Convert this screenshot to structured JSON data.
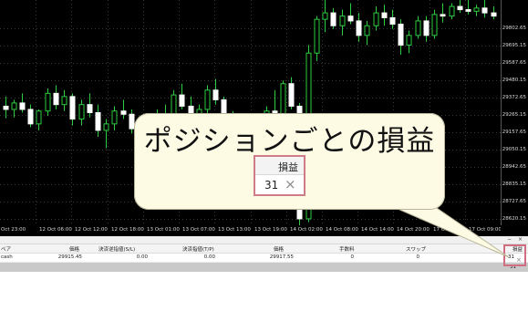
{
  "chart": {
    "background": "#000000",
    "candle_color": "#2ecc40",
    "doji_color": "#ffffff",
    "candles": [
      {
        "o": 29320,
        "h": 29380,
        "l": 29245,
        "c": 29300
      },
      {
        "o": 29300,
        "h": 29360,
        "l": 29250,
        "c": 29340
      },
      {
        "o": 29340,
        "h": 29400,
        "l": 29280,
        "c": 29300
      },
      {
        "o": 29300,
        "h": 29330,
        "l": 29190,
        "c": 29210
      },
      {
        "o": 29210,
        "h": 29300,
        "l": 29170,
        "c": 29290
      },
      {
        "o": 29290,
        "h": 29430,
        "l": 29260,
        "c": 29400
      },
      {
        "o": 29400,
        "h": 29450,
        "l": 29300,
        "c": 29330
      },
      {
        "o": 29330,
        "h": 29420,
        "l": 29290,
        "c": 29380
      },
      {
        "o": 29380,
        "h": 29400,
        "l": 29200,
        "c": 29240
      },
      {
        "o": 29240,
        "h": 29360,
        "l": 29200,
        "c": 29330
      },
      {
        "o": 29330,
        "h": 29400,
        "l": 29250,
        "c": 29280
      },
      {
        "o": 29280,
        "h": 29330,
        "l": 29130,
        "c": 29170
      },
      {
        "o": 29170,
        "h": 29240,
        "l": 29060,
        "c": 29210
      },
      {
        "o": 29210,
        "h": 29320,
        "l": 29170,
        "c": 29290
      },
      {
        "o": 29290,
        "h": 29360,
        "l": 29240,
        "c": 29270
      },
      {
        "o": 29270,
        "h": 29300,
        "l": 29150,
        "c": 29180
      },
      {
        "o": 29180,
        "h": 29260,
        "l": 29080,
        "c": 29100
      },
      {
        "o": 29100,
        "h": 29210,
        "l": 29040,
        "c": 29190
      },
      {
        "o": 29190,
        "h": 29300,
        "l": 29160,
        "c": 29270
      },
      {
        "o": 29270,
        "h": 29330,
        "l": 29180,
        "c": 29220
      },
      {
        "o": 29220,
        "h": 29420,
        "l": 29200,
        "c": 29390
      },
      {
        "o": 29390,
        "h": 29460,
        "l": 29300,
        "c": 29320
      },
      {
        "o": 29320,
        "h": 29380,
        "l": 29200,
        "c": 29240
      },
      {
        "o": 29240,
        "h": 29330,
        "l": 29180,
        "c": 29300
      },
      {
        "o": 29300,
        "h": 29450,
        "l": 29270,
        "c": 29420
      },
      {
        "o": 29420,
        "h": 29490,
        "l": 29330,
        "c": 29360
      },
      {
        "o": 29360,
        "h": 29380,
        "l": 29180,
        "c": 29210
      },
      {
        "o": 29210,
        "h": 29290,
        "l": 29100,
        "c": 29150
      },
      {
        "o": 29150,
        "h": 29180,
        "l": 28900,
        "c": 28940
      },
      {
        "o": 28940,
        "h": 29100,
        "l": 28880,
        "c": 29070
      },
      {
        "o": 29070,
        "h": 29240,
        "l": 29020,
        "c": 29180
      },
      {
        "o": 29180,
        "h": 29320,
        "l": 29140,
        "c": 29290
      },
      {
        "o": 29290,
        "h": 29420,
        "l": 29230,
        "c": 29250
      },
      {
        "o": 29250,
        "h": 29480,
        "l": 29200,
        "c": 29460
      },
      {
        "o": 29460,
        "h": 29500,
        "l": 29300,
        "c": 29320
      },
      {
        "o": 29320,
        "h": 29340,
        "l": 28560,
        "c": 28620
      },
      {
        "o": 28620,
        "h": 29700,
        "l": 28600,
        "c": 29650
      },
      {
        "o": 29650,
        "h": 29880,
        "l": 29600,
        "c": 29860
      },
      {
        "o": 29860,
        "h": 29990,
        "l": 29780,
        "c": 29900
      },
      {
        "o": 29900,
        "h": 29930,
        "l": 29800,
        "c": 29820
      },
      {
        "o": 29820,
        "h": 29920,
        "l": 29760,
        "c": 29880
      },
      {
        "o": 29880,
        "h": 29960,
        "l": 29830,
        "c": 29850
      },
      {
        "o": 29850,
        "h": 29900,
        "l": 29720,
        "c": 29760
      },
      {
        "o": 29760,
        "h": 29850,
        "l": 29700,
        "c": 29820
      },
      {
        "o": 29820,
        "h": 29940,
        "l": 29790,
        "c": 29900
      },
      {
        "o": 29900,
        "h": 29950,
        "l": 29820,
        "c": 29870
      },
      {
        "o": 29870,
        "h": 29920,
        "l": 29800,
        "c": 29830
      },
      {
        "o": 29830,
        "h": 29860,
        "l": 29640,
        "c": 29700
      },
      {
        "o": 29700,
        "h": 29790,
        "l": 29650,
        "c": 29760
      },
      {
        "o": 29760,
        "h": 29880,
        "l": 29740,
        "c": 29850
      },
      {
        "o": 29850,
        "h": 29880,
        "l": 29720,
        "c": 29760
      },
      {
        "o": 29760,
        "h": 29920,
        "l": 29740,
        "c": 29890
      },
      {
        "o": 29890,
        "h": 29960,
        "l": 29840,
        "c": 29880
      },
      {
        "o": 29880,
        "h": 29960,
        "l": 29860,
        "c": 29940
      },
      {
        "o": 29940,
        "h": 29990,
        "l": 29900,
        "c": 29920
      },
      {
        "o": 29920,
        "h": 29980,
        "l": 29890,
        "c": 29910
      },
      {
        "o": 29910,
        "h": 29950,
        "l": 29880,
        "c": 29930
      },
      {
        "o": 29930,
        "h": 29990,
        "l": 29870,
        "c": 29900
      },
      {
        "o": 29900,
        "h": 29940,
        "l": 29860,
        "c": 29880
      }
    ],
    "y_range": [
      28580,
      29980
    ]
  },
  "price_axis": [
    {
      "label": "29802.65",
      "value": 29802.65
    },
    {
      "label": "29695.15",
      "value": 29695.15
    },
    {
      "label": "29587.65",
      "value": 29587.65
    },
    {
      "label": "29480.15",
      "value": 29480.15
    },
    {
      "label": "29372.65",
      "value": 29372.65
    },
    {
      "label": "29265.15",
      "value": 29265.15
    },
    {
      "label": "29157.65",
      "value": 29157.65
    },
    {
      "label": "29050.15",
      "value": 29050.15
    },
    {
      "label": "28942.65",
      "value": 28942.65
    },
    {
      "label": "28835.15",
      "value": 28835.15
    },
    {
      "label": "28727.65",
      "value": 28727.65
    },
    {
      "label": "28620.15",
      "value": 28620.15
    }
  ],
  "time_axis": [
    "Oct 23:00",
    "12 Oct 06:00",
    "12 Oct 12:00",
    "12 Oct 18:00",
    "13 Oct 01:00",
    "13 Oct 07:00",
    "13 Oct 13:00",
    "13 Oct 19:00",
    "14 Oct 02:00",
    "14 Oct 08:00",
    "14 Oct 14:00",
    "14 Oct 20:00",
    "17 Oct 03:00",
    "17 Oct 09:00"
  ],
  "panel": {
    "strip_buttons": [
      "−",
      "×"
    ],
    "headers": {
      "pair": "ペア",
      "price": "価格",
      "stop_loss": "決済逆指値(S/L)",
      "take_profit": "決済指値(T/P)",
      "price2": "価格",
      "commission": "手数料",
      "swap": "スワップ",
      "profit": "損益"
    },
    "row": {
      "pair": "cash",
      "price": "29915.45",
      "stop_loss": "0.00",
      "take_profit": "0.00",
      "price2": "29917.55",
      "commission": "0",
      "swap": "0",
      "profit": "31"
    },
    "total": "31"
  },
  "callout": {
    "title": "ポジションごとの損益",
    "header": "損益",
    "value": "31",
    "close_glyph": "×",
    "highlight_color": "#cf7c88",
    "background": "#fdfbe4"
  }
}
